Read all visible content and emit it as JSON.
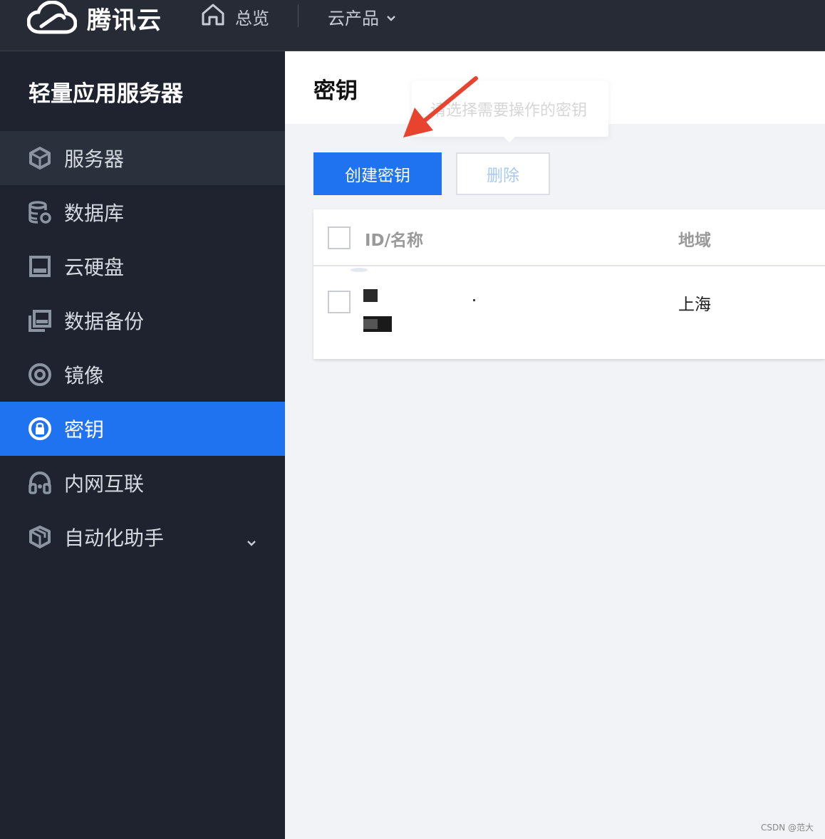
{
  "topbar": {
    "brand": "腾讯云",
    "home_label": "总览",
    "products_label": "云产品"
  },
  "sidebar": {
    "title": "轻量应用服务器",
    "items": [
      {
        "label": "服务器",
        "icon": "cube-icon"
      },
      {
        "label": "数据库",
        "icon": "database-icon"
      },
      {
        "label": "云硬盘",
        "icon": "disk-icon"
      },
      {
        "label": "数据备份",
        "icon": "backup-icon"
      },
      {
        "label": "镜像",
        "icon": "disc-icon"
      },
      {
        "label": "密钥",
        "icon": "key-lock-icon"
      },
      {
        "label": "内网互联",
        "icon": "headset-icon"
      },
      {
        "label": "自动化助手",
        "icon": "package-icon"
      }
    ],
    "active_index": 5
  },
  "page": {
    "title": "密钥",
    "tooltip": "请选择需要操作的密钥",
    "create_button": "创建密钥",
    "delete_button": "删除"
  },
  "table": {
    "columns": [
      "ID/名称",
      "地域"
    ],
    "rows": [
      {
        "id_name": "",
        "region": "上海"
      }
    ]
  },
  "watermark": "CSDN @范大",
  "colors": {
    "topbar_bg": "#262b36",
    "sidebar_bg": "#1f2330",
    "accent": "#1f73f1",
    "annotation_arrow": "#e8432f"
  }
}
